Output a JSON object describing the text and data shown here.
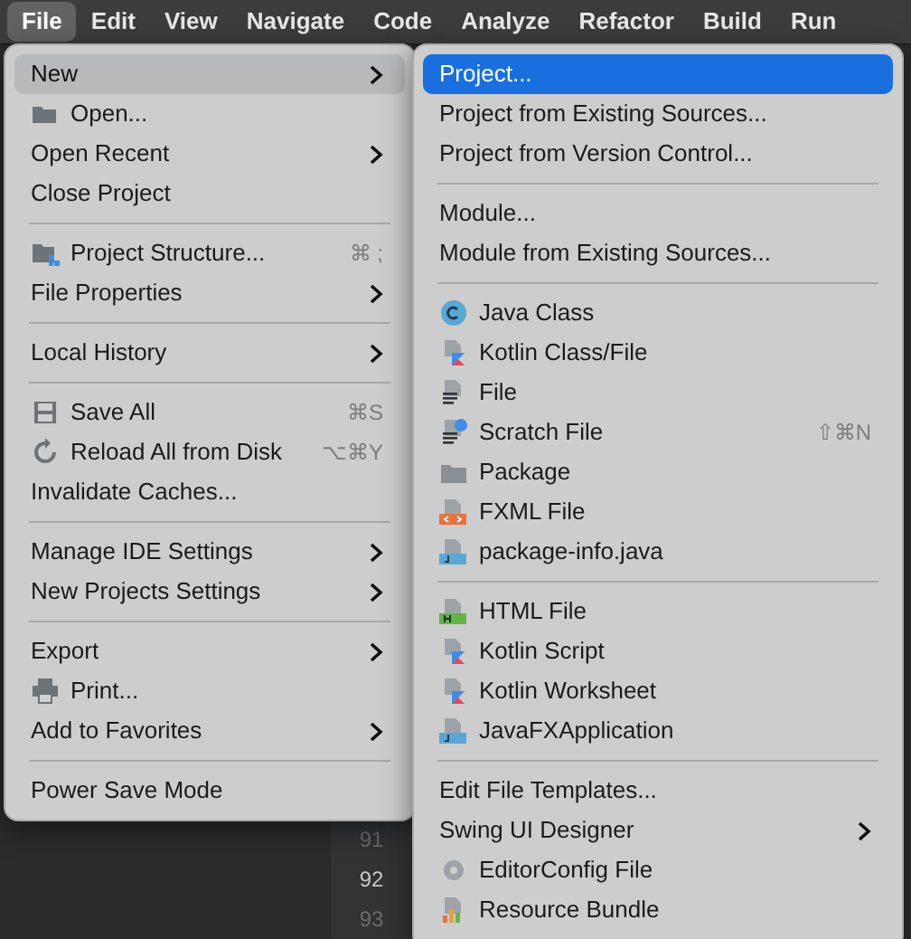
{
  "menu_bar": [
    {
      "label": "File",
      "selected": true
    },
    {
      "label": "Edit",
      "selected": false
    },
    {
      "label": "View",
      "selected": false
    },
    {
      "label": "Navigate",
      "selected": false
    },
    {
      "label": "Code",
      "selected": false
    },
    {
      "label": "Analyze",
      "selected": false
    },
    {
      "label": "Refactor",
      "selected": false
    },
    {
      "label": "Build",
      "selected": false
    },
    {
      "label": "Run",
      "selected": false
    }
  ],
  "file_menu": [
    {
      "kind": "plain",
      "label": "New",
      "submenu": true,
      "selected": true
    },
    {
      "kind": "folder",
      "label": "Open...",
      "selected": false
    },
    {
      "kind": "plain",
      "label": "Open Recent",
      "submenu": true,
      "selected": false
    },
    {
      "kind": "plain",
      "label": "Close Project",
      "selected": false
    },
    {
      "kind": "separator"
    },
    {
      "kind": "structure",
      "label": "Project Structure...",
      "shortcut": "⌘ ;",
      "selected": false
    },
    {
      "kind": "plain",
      "label": "File Properties",
      "submenu": true,
      "selected": false
    },
    {
      "kind": "separator"
    },
    {
      "kind": "plain",
      "label": "Local History",
      "submenu": true,
      "selected": false
    },
    {
      "kind": "separator"
    },
    {
      "kind": "save",
      "label": "Save All",
      "shortcut": "⌘S",
      "selected": false
    },
    {
      "kind": "reload",
      "label": "Reload All from Disk",
      "shortcut": "⌥⌘Y",
      "selected": false
    },
    {
      "kind": "plain",
      "label": "Invalidate Caches...",
      "selected": false
    },
    {
      "kind": "separator"
    },
    {
      "kind": "plain",
      "label": "Manage IDE Settings",
      "submenu": true,
      "selected": false
    },
    {
      "kind": "plain",
      "label": "New Projects Settings",
      "submenu": true,
      "selected": false
    },
    {
      "kind": "separator"
    },
    {
      "kind": "plain",
      "label": "Export",
      "submenu": true,
      "selected": false
    },
    {
      "kind": "print",
      "label": "Print...",
      "selected": false
    },
    {
      "kind": "plain",
      "label": "Add to Favorites",
      "submenu": true,
      "selected": false
    },
    {
      "kind": "separator"
    },
    {
      "kind": "plain",
      "label": "Power Save Mode",
      "selected": false
    }
  ],
  "new_submenu": [
    {
      "kind": "plain",
      "label": "Project...",
      "selected": true
    },
    {
      "kind": "plain",
      "label": "Project from Existing Sources...",
      "selected": false
    },
    {
      "kind": "plain",
      "label": "Project from Version Control...",
      "selected": false
    },
    {
      "kind": "separator"
    },
    {
      "kind": "plain",
      "label": "Module...",
      "selected": false
    },
    {
      "kind": "plain",
      "label": "Module from Existing Sources...",
      "selected": false
    },
    {
      "kind": "separator"
    },
    {
      "kind": "javaclass",
      "label": "Java Class",
      "selected": false
    },
    {
      "kind": "kotlin",
      "label": "Kotlin Class/File",
      "selected": false
    },
    {
      "kind": "file",
      "label": "File",
      "selected": false
    },
    {
      "kind": "scratch",
      "label": "Scratch File",
      "shortcut": "⇧⌘N",
      "selected": false
    },
    {
      "kind": "package",
      "label": "Package",
      "selected": false
    },
    {
      "kind": "fxml",
      "label": "FXML File",
      "selected": false
    },
    {
      "kind": "javafile",
      "label": "package-info.java",
      "selected": false
    },
    {
      "kind": "separator"
    },
    {
      "kind": "html",
      "label": "HTML File",
      "selected": false
    },
    {
      "kind": "kotlin",
      "label": "Kotlin Script",
      "selected": false
    },
    {
      "kind": "kotlin",
      "label": "Kotlin Worksheet",
      "selected": false
    },
    {
      "kind": "javafile",
      "label": "JavaFXApplication",
      "selected": false
    },
    {
      "kind": "separator"
    },
    {
      "kind": "plain",
      "label": "Edit File Templates...",
      "selected": false
    },
    {
      "kind": "plain",
      "label": "Swing UI Designer",
      "submenu": true,
      "selected": false
    },
    {
      "kind": "gear",
      "label": "EditorConfig File",
      "selected": false
    },
    {
      "kind": "bundle",
      "label": "Resource Bundle",
      "selected": false
    }
  ],
  "editor": {
    "line_numbers": [
      "91",
      "92",
      "93"
    ]
  }
}
